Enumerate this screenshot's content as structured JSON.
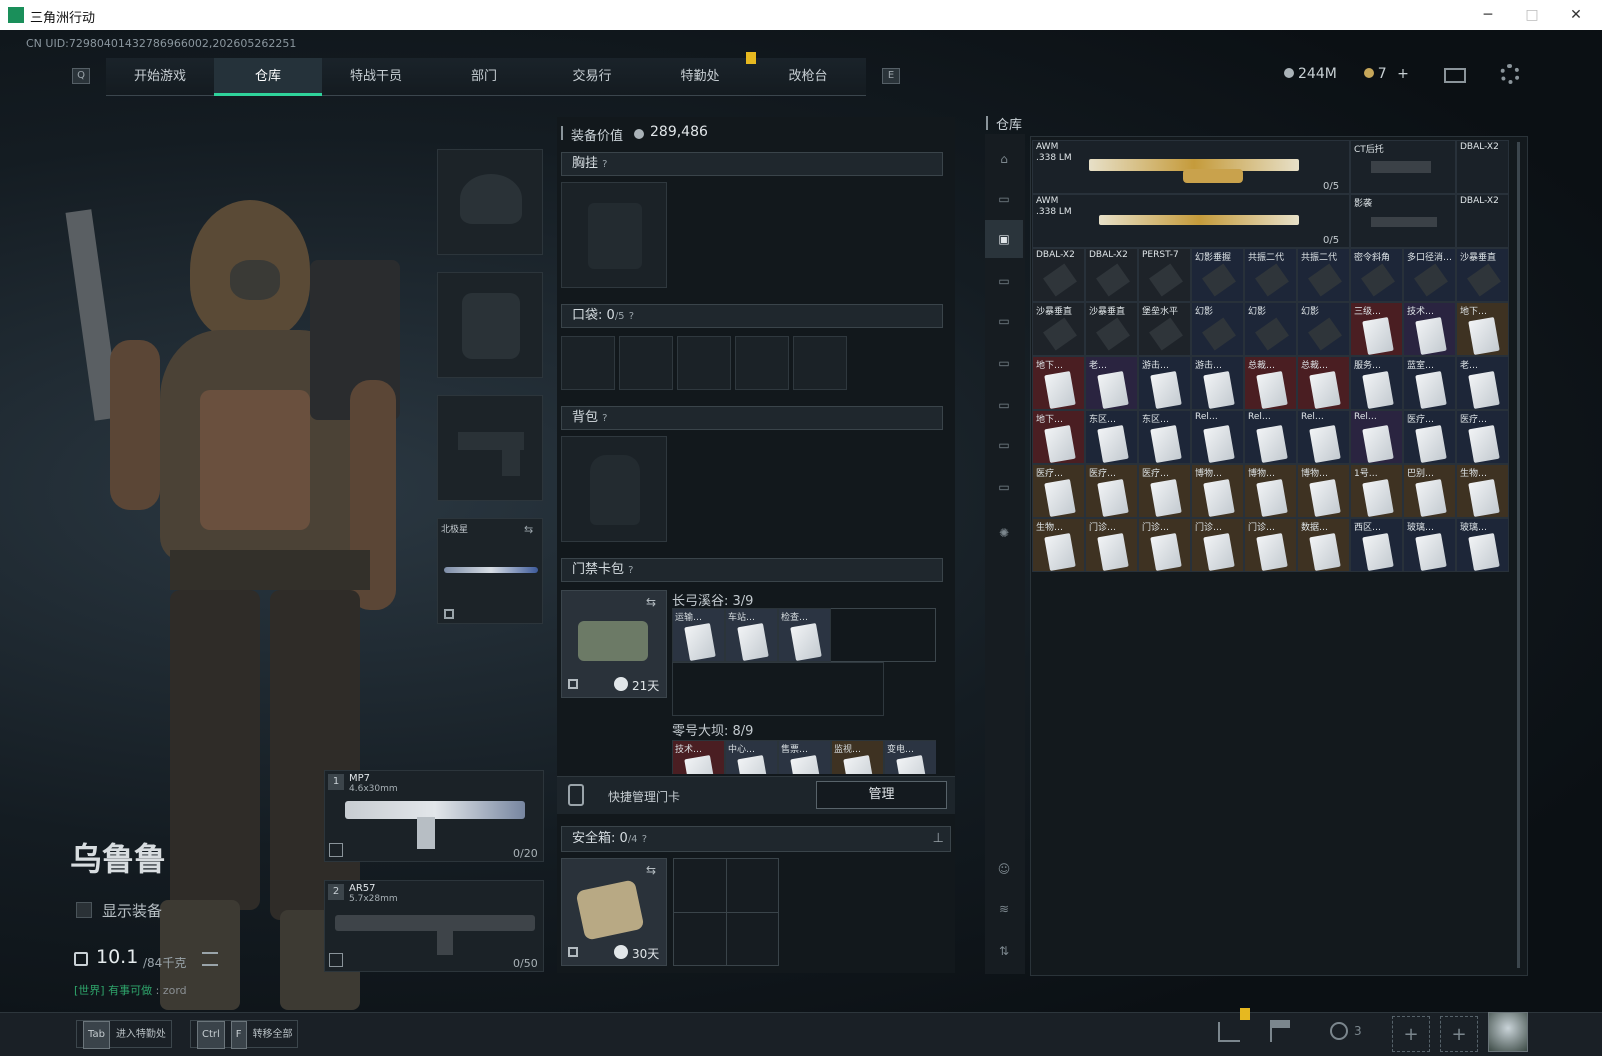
{
  "window": {
    "title": "三角洲行动",
    "minimize": "─",
    "maximize": "□",
    "close": "✕"
  },
  "uid": "CN UID:7298040143278696600​2,202605262251",
  "nav": {
    "left_key": "Q",
    "right_key": "E",
    "tabs": [
      "开始游戏",
      "仓库",
      "特战干员",
      "部门",
      "交易行",
      "特勤处",
      "改枪台"
    ],
    "active": "仓库"
  },
  "currency": {
    "silver": "244M",
    "gold": "7",
    "plus": "+"
  },
  "character": {
    "name": "乌鲁鲁",
    "show_equipment": "显示装备",
    "weight": "10.1",
    "weight_max": "/84千克",
    "chat_prefix": "[世界]",
    "chat_text": "有事可做",
    "chat_user": "zord"
  },
  "slots": {
    "melee_label": "北极星",
    "primary": {
      "index": "1",
      "name": "MP7",
      "ammo": "4.6x30mm",
      "count": "0/20"
    },
    "secondary": {
      "index": "2",
      "name": "AR57",
      "ammo": "5.7x28mm",
      "count": "0/50"
    }
  },
  "middle": {
    "value_label": "装备价值",
    "value": "289,486",
    "chest_label": "胸挂",
    "pocket_label": "口袋:",
    "pocket_count": "0",
    "pocket_max": "/5",
    "backpack_label": "背包",
    "keycard_label": "门禁卡包",
    "keycard_days": "21天",
    "map1": "长弓溪谷: 3/9",
    "map1_cards": [
      "运输…",
      "车站…",
      "检查…"
    ],
    "map2": "零号大坝: 8/9",
    "map2_cards": [
      "技术…",
      "中心…",
      "售票…",
      "监视…",
      "变电…"
    ],
    "quick_manage": "快捷管理门卡",
    "manage_button": "管理",
    "safe_label": "安全箱:",
    "safe_count": "0",
    "safe_max": "/4",
    "safe_days": "30天",
    "help": "?"
  },
  "stash": {
    "title": "仓库",
    "awm1": {
      "name": "AWM",
      "ammo": ".338 LM",
      "count": "0/5"
    },
    "awm2": {
      "name": "AWM",
      "ammo": ".338 LM",
      "count": "0/5"
    },
    "labels_row0_right": [
      "CT后托",
      "DBAL-X2"
    ],
    "labels_row1_right": [
      "影袭",
      "DBAL-X2"
    ],
    "row2": [
      "DBAL-X2",
      "DBAL-X2",
      "PERST-7",
      "幻影垂握",
      "共振二代",
      "共振二代",
      "密令斜角",
      "多口径消…",
      "沙暴垂直"
    ],
    "row3": [
      "沙暴垂直",
      "沙暴垂直",
      "堡垒水平",
      "幻影",
      "幻影",
      "幻影",
      "三级…",
      "技术…",
      "地下…"
    ],
    "row4": [
      "地下…",
      "老…",
      "游击…",
      "游击…",
      "总裁…",
      "总裁…",
      "服务…",
      "蓝室…",
      "老…"
    ],
    "row5": [
      "地下…",
      "东区…",
      "东区…",
      "Rel…",
      "Rel…",
      "Rel…",
      "Rel…",
      "医疗…",
      "医疗…"
    ],
    "row6": [
      "医疗…",
      "医疗…",
      "医疗…",
      "博物…",
      "博物…",
      "博物…",
      "1号…",
      "巴别…",
      "生物…"
    ],
    "row7": [
      "生物…",
      "门诊…",
      "门诊…",
      "门诊…",
      "门诊…",
      "数据…",
      "西区…",
      "玻璃…",
      "玻璃…"
    ]
  },
  "bottom": {
    "tab_key": "Tab",
    "tab_text": "进入特勤处",
    "ctrl_key": "Ctrl",
    "f_key": "F",
    "transfer_text": "转移全部",
    "friends_count": "3"
  },
  "colors": {
    "accent": "#2fd39b",
    "rare_red": "#4a1e22",
    "rare_gold": "#3e3222"
  }
}
